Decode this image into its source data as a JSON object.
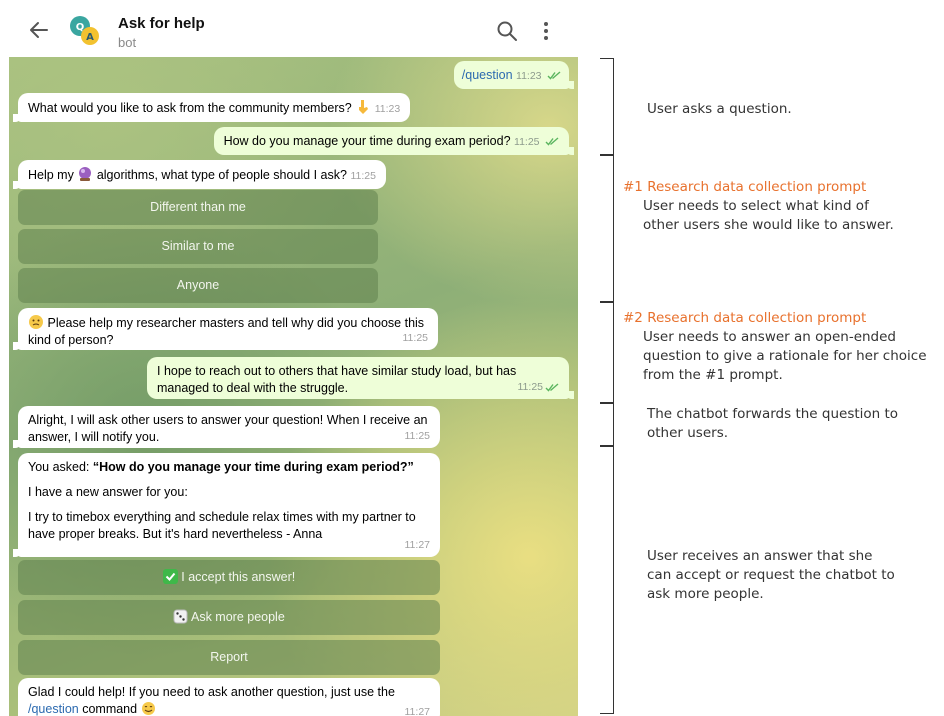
{
  "header": {
    "title": "Ask for help",
    "subtitle": "bot"
  },
  "messages": {
    "m1": {
      "text": "/question",
      "time": "11:23"
    },
    "m2": {
      "text": "What would you like to ask from the community members?",
      "time": "11:23"
    },
    "m3": {
      "text": "How do you manage your time during exam period?",
      "time": "11:25"
    },
    "m4": {
      "text_a": "Help my",
      "text_b": "algorithms, what type of people should I ask?",
      "time": "11:25"
    },
    "m5": {
      "line1": "Please help my researcher masters and tell why did you choose this",
      "line2": "kind of person?",
      "time": "11:25"
    },
    "m6": {
      "line1": "I hope to reach out to others that have similar study load, but has",
      "line2": "managed to deal with the struggle.",
      "time": "11:25"
    },
    "m7": {
      "line1": "Alright, I will ask other users to answer your question! When I receive an",
      "line2": "answer, I will notify you.",
      "time": "11:25"
    },
    "m8": {
      "asked_prefix": "You asked: ",
      "asked_question": "“How do you manage your time during exam period?”",
      "new_answer": "I have a new answer for you:",
      "answer_line1": "I try to timebox everything and schedule relax times with my partner to",
      "answer_line2": "have proper breaks. But it's hard nevertheless - Anna",
      "time": "11:27"
    },
    "m9": {
      "line1": "Glad I could help! If you need to ask another question, just use the",
      "command": "/question",
      "suffix": " command",
      "time": "11:27"
    }
  },
  "keyboards": {
    "people_type": [
      "Different than me",
      "Similar to me",
      "Anyone"
    ],
    "answer_actions": {
      "accept": "I accept this answer!",
      "ask_more": "Ask more people",
      "report": "Report"
    }
  },
  "annotations": {
    "a1": "User asks a question.",
    "a2": {
      "heading": "#1 Research data collection prompt",
      "line1": "User needs to select what kind of",
      "line2": "other users she would like to answer."
    },
    "a3": {
      "heading": "#2 Research data collection prompt",
      "line1": "User needs to answer an open-ended",
      "line2": "question to give a rationale for her choice",
      "line3": "from the #1 prompt."
    },
    "a4": {
      "line1": "The chatbot forwards the question to",
      "line2": "other users."
    },
    "a5": {
      "line1": "User receives an answer that she",
      "line2": "can accept or request the chatbot to",
      "line3": "ask more people."
    }
  },
  "colors": {
    "accent_orange": "#e8712d",
    "outgoing_bubble": "#eefed8",
    "incoming_bubble": "#ffffff",
    "command_link": "#2c6ab0",
    "icons": [
      "arrow-left-icon",
      "bot-avatar-icon",
      "search-icon",
      "more-vertical-icon",
      "double-check-icon",
      "pointing-down-emoji",
      "crystal-ball-emoji",
      "thinking-face-emoji",
      "check-mark-button-emoji",
      "dice-emoji",
      "smiling-face-emoji"
    ]
  }
}
